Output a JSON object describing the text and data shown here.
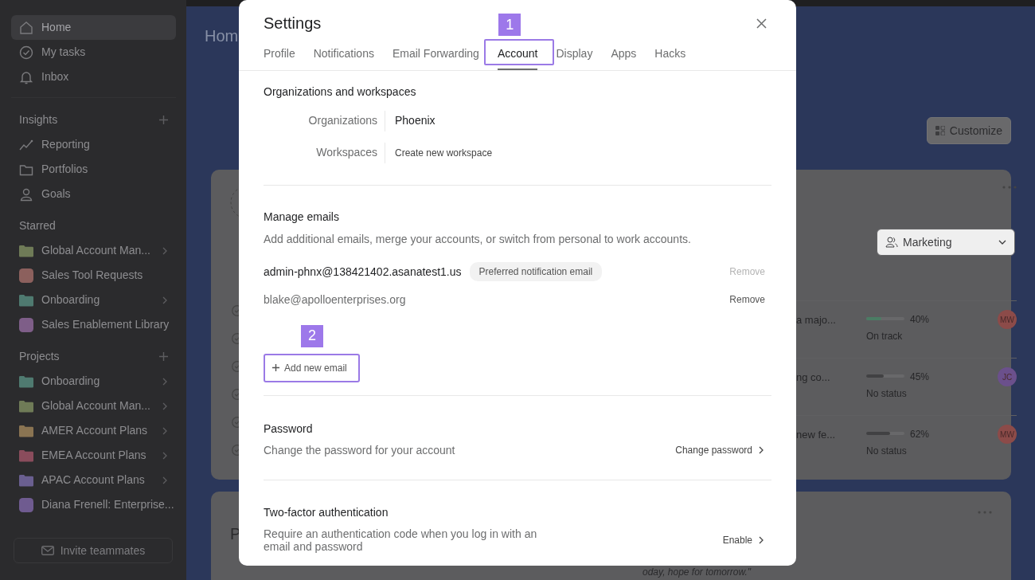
{
  "sidebar": {
    "nav": [
      {
        "label": "Home",
        "selected": true
      },
      {
        "label": "My tasks",
        "selected": false
      },
      {
        "label": "Inbox",
        "selected": false
      }
    ],
    "sections": [
      {
        "title": "Insights",
        "has_add": true,
        "items": [
          {
            "label": "Reporting",
            "kind": "reporting"
          },
          {
            "label": "Portfolios",
            "kind": "portfolios"
          },
          {
            "label": "Goals",
            "kind": "goals"
          }
        ]
      },
      {
        "title": "Starred",
        "has_add": false,
        "items": [
          {
            "label": "Global Account Man...",
            "kind": "folder",
            "color": "#6f7b57"
          },
          {
            "label": "Sales Tool Requests",
            "kind": "project",
            "color": "#8c605d"
          },
          {
            "label": "Onboarding",
            "kind": "folder",
            "color": "#4f7a70"
          },
          {
            "label": "Sales Enablement Library",
            "kind": "project",
            "color": "#7e5e88"
          }
        ]
      },
      {
        "title": "Projects",
        "has_add": true,
        "items": [
          {
            "label": "Onboarding",
            "kind": "folder",
            "color": "#4f7a70"
          },
          {
            "label": "Global Account Man...",
            "kind": "folder",
            "color": "#6f7b57"
          },
          {
            "label": "AMER Account Plans",
            "kind": "folder",
            "color": "#8a7452"
          },
          {
            "label": "EMEA Account Plans",
            "kind": "folder",
            "color": "#8a4c5c"
          },
          {
            "label": "APAC Account Plans",
            "kind": "folder",
            "color": "#6a5f90"
          },
          {
            "label": "Diana Frenell: Enterprise...",
            "kind": "project",
            "color": "#6f5b90"
          }
        ]
      }
    ],
    "invite_button": "Invite teammates"
  },
  "home": {
    "title": "Hom",
    "customize_button": "Customize",
    "card": {
      "filter": "Marketing",
      "rows": [
        {
          "text": "a majo...",
          "level": 0.4,
          "percent": "40%",
          "status": "On track",
          "color": "#4b7c64",
          "avatar": {
            "initials": "MW",
            "color": "#8c4b49"
          }
        },
        {
          "text": "ng co...",
          "level": 0.45,
          "percent": "45%",
          "status": "No status",
          "color": "#414143",
          "avatar": {
            "initials": "JC",
            "color": "#6b508c"
          }
        },
        {
          "text": "new fe...",
          "level": 0.62,
          "percent": "62%",
          "status": "No status",
          "color": "#414143",
          "avatar": {
            "initials": "MW",
            "color": "#8c4b49"
          }
        }
      ],
      "tasks": [
        {
          "checked": false
        },
        {
          "checked": false
        },
        {
          "checked": false
        },
        {
          "checked": false
        },
        {
          "checked": false
        },
        {
          "checked": false
        }
      ]
    },
    "card_2": {
      "title": "P",
      "quote": "oday, hope for tomorrow.\""
    }
  },
  "settings": {
    "title": "Settings",
    "tabs": [
      {
        "label": "Profile",
        "selected": false,
        "highlighted": false
      },
      {
        "label": "Notifications",
        "selected": false,
        "highlighted": false
      },
      {
        "label": "Email Forwarding",
        "selected": false,
        "highlighted": false
      },
      {
        "label": "Account",
        "selected": true,
        "highlighted": true,
        "callout": "1"
      },
      {
        "label": "Display",
        "selected": false,
        "highlighted": false
      },
      {
        "label": "Apps",
        "selected": false,
        "highlighted": false
      },
      {
        "label": "Hacks",
        "selected": false,
        "highlighted": false
      }
    ],
    "organizations": {
      "title": "Organizations and workspaces",
      "rows": [
        {
          "label": "Organizations",
          "value": "Phoenix",
          "kind": "value"
        },
        {
          "label": "Workspaces",
          "value": "Create new workspace",
          "kind": "link"
        }
      ]
    },
    "emails": {
      "title": "Manage emails",
      "description": "Add additional emails, merge your accounts, or switch from personal to work accounts.",
      "items": [
        {
          "address": "admin-phnx@138421402.asanatest1.us",
          "badge": "Preferred notification email",
          "primary": true,
          "remove": "Remove",
          "remove_disabled": true
        },
        {
          "address": "blake@apolloenterprises.org",
          "primary": false,
          "remove": "Remove",
          "remove_disabled": false
        }
      ],
      "add_button": {
        "label": "Add new email",
        "highlighted": true,
        "callout": "2"
      }
    },
    "password": {
      "title": "Password",
      "description": "Change the password for your account",
      "action": "Change password"
    },
    "two_factor": {
      "title": "Two-factor authentication",
      "description": "Require an authentication code when you log in with an email and password",
      "action": "Enable"
    }
  }
}
